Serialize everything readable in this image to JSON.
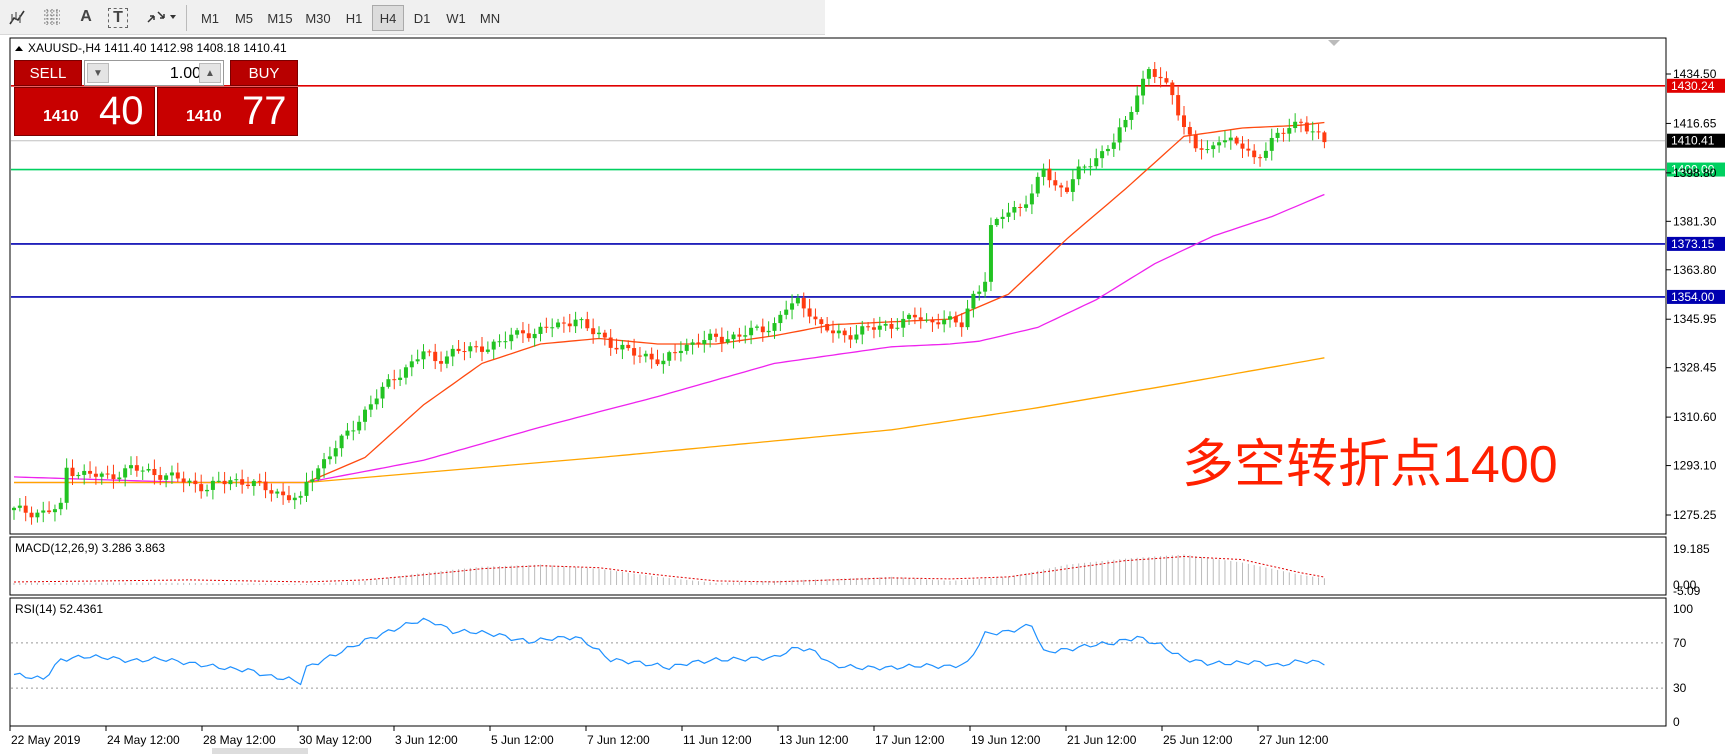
{
  "toolbar": {
    "icons": [
      "chart-type-icon",
      "grid-icon",
      "text-icon",
      "text-label-icon",
      "arrows-icon"
    ],
    "text_icon_label": "A",
    "text_label_icon_label": "T",
    "timeframes": [
      "M1",
      "M5",
      "M15",
      "M30",
      "H1",
      "H4",
      "D1",
      "W1",
      "MN"
    ],
    "active_timeframe": "H4"
  },
  "header": {
    "symbol_info": "XAUUSD-,H4  1411.40 1412.98 1408.18 1410.41"
  },
  "trade": {
    "sell_label": "SELL",
    "buy_label": "BUY",
    "lot_value": "1.00",
    "sell_price_prefix": "1410",
    "sell_price_main": "40",
    "buy_price_prefix": "1410",
    "buy_price_main": "77"
  },
  "annotation": "多空转折点1400",
  "colors": {
    "bull": "#22c322",
    "bear": "#ff3b10",
    "ma_fast": "#ff4a10",
    "ma_mid": "#ee22ee",
    "ma_slow": "#ffa500",
    "resistance": "#e00000",
    "support": "#00d060",
    "level_blue": "#0000b0",
    "annotation": "#ff2000"
  },
  "chart_data": [
    {
      "type": "candlestick",
      "title": "XAUUSD-,H4",
      "ohlc_last": {
        "open": 1411.4,
        "high": 1412.98,
        "low": 1408.18,
        "close": 1410.41
      },
      "price_ticks": [
        "1434.50",
        "1416.65",
        "1398.80",
        "1381.30",
        "1363.80",
        "1345.95",
        "1328.45",
        "1310.60",
        "1293.10",
        "1275.25"
      ],
      "x_labels": [
        "22 May 2019",
        "24 May 12:00",
        "28 May 12:00",
        "30 May 12:00",
        "3 Jun 12:00",
        "5 Jun 12:00",
        "7 Jun 12:00",
        "11 Jun 12:00",
        "13 Jun 12:00",
        "17 Jun 12:00",
        "19 Jun 12:00",
        "21 Jun 12:00",
        "25 Jun 12:00",
        "27 Jun 12:00"
      ],
      "horizontal_lines": [
        {
          "value": 1430.24,
          "label": "1430.24",
          "color": "#e00000"
        },
        {
          "value": 1410.41,
          "label": "1410.41",
          "color": "#c0c0c0"
        },
        {
          "value": 1400.0,
          "label": "1400.00",
          "color": "#00d060"
        },
        {
          "value": 1373.15,
          "label": "1373.15",
          "color": "#0000b0"
        },
        {
          "value": 1354.0,
          "label": "1354.00",
          "color": "#0000b0"
        }
      ],
      "close_path": [
        [
          0,
          1277
        ],
        [
          5,
          1276
        ],
        [
          8,
          1278
        ],
        [
          9,
          1292
        ],
        [
          12,
          1290
        ],
        [
          16,
          1289
        ],
        [
          20,
          1292
        ],
        [
          25,
          1290
        ],
        [
          30,
          1287
        ],
        [
          33,
          1285
        ],
        [
          37,
          1288
        ],
        [
          40,
          1287
        ],
        [
          44,
          1284
        ],
        [
          47,
          1282
        ],
        [
          49,
          1280
        ],
        [
          50,
          1287
        ],
        [
          53,
          1295
        ],
        [
          56,
          1302
        ],
        [
          59,
          1310
        ],
        [
          62,
          1318
        ],
        [
          65,
          1325
        ],
        [
          68,
          1330
        ],
        [
          70,
          1334
        ],
        [
          72,
          1331
        ],
        [
          75,
          1334
        ],
        [
          78,
          1335
        ],
        [
          80,
          1336
        ],
        [
          83,
          1337
        ],
        [
          85,
          1340
        ],
        [
          87,
          1342
        ],
        [
          89,
          1340
        ],
        [
          91,
          1343
        ],
        [
          93,
          1344
        ],
        [
          96,
          1346
        ],
        [
          98,
          1342
        ],
        [
          100,
          1341
        ],
        [
          102,
          1337
        ],
        [
          105,
          1334
        ],
        [
          108,
          1333
        ],
        [
          111,
          1330
        ],
        [
          112,
          1332
        ],
        [
          114,
          1336
        ],
        [
          117,
          1338
        ],
        [
          120,
          1339
        ],
        [
          124,
          1340
        ],
        [
          127,
          1342
        ],
        [
          130,
          1344
        ],
        [
          132,
          1350
        ],
        [
          134,
          1352
        ],
        [
          136,
          1349
        ],
        [
          138,
          1343
        ],
        [
          140,
          1341
        ],
        [
          142,
          1340
        ],
        [
          145,
          1342
        ],
        [
          148,
          1343
        ],
        [
          150,
          1344
        ],
        [
          152,
          1345
        ],
        [
          154,
          1347
        ],
        [
          156,
          1345
        ],
        [
          158,
          1346
        ],
        [
          160,
          1345
        ],
        [
          162,
          1344
        ],
        [
          164,
          1355
        ],
        [
          166,
          1360
        ],
        [
          167,
          1378
        ],
        [
          169,
          1384
        ],
        [
          172,
          1387
        ],
        [
          174,
          1390
        ],
        [
          176,
          1401
        ],
        [
          178,
          1394
        ],
        [
          180,
          1393
        ],
        [
          182,
          1399
        ],
        [
          184,
          1403
        ],
        [
          186,
          1406
        ],
        [
          188,
          1410
        ],
        [
          190,
          1417
        ],
        [
          192,
          1428
        ],
        [
          194,
          1436
        ],
        [
          196,
          1432
        ],
        [
          198,
          1428
        ],
        [
          200,
          1415
        ],
        [
          202,
          1408
        ],
        [
          204,
          1406
        ],
        [
          206,
          1412
        ],
        [
          208,
          1410
        ],
        [
          210,
          1408
        ],
        [
          212,
          1404
        ],
        [
          214,
          1408
        ],
        [
          216,
          1412
        ],
        [
          218,
          1415
        ],
        [
          220,
          1418
        ],
        [
          222,
          1413
        ],
        [
          224,
          1410
        ]
      ],
      "moving_averages": [
        {
          "name": "MA fast",
          "color": "#ff4a10",
          "path": [
            [
              0,
              1287
            ],
            [
              20,
              1287
            ],
            [
              50,
              1287
            ],
            [
              60,
              1296
            ],
            [
              70,
              1315
            ],
            [
              80,
              1330
            ],
            [
              90,
              1337
            ],
            [
              100,
              1339
            ],
            [
              110,
              1337
            ],
            [
              120,
              1337
            ],
            [
              130,
              1340
            ],
            [
              140,
              1344
            ],
            [
              150,
              1345
            ],
            [
              160,
              1346
            ],
            [
              170,
              1355
            ],
            [
              180,
              1375
            ],
            [
              190,
              1393
            ],
            [
              200,
              1412
            ],
            [
              210,
              1415
            ],
            [
              220,
              1416
            ],
            [
              224,
              1417
            ]
          ]
        },
        {
          "name": "MA mid",
          "color": "#ee22ee",
          "path": [
            [
              0,
              1289
            ],
            [
              30,
              1287
            ],
            [
              50,
              1287
            ],
            [
              70,
              1295
            ],
            [
              90,
              1307
            ],
            [
              110,
              1318
            ],
            [
              130,
              1330
            ],
            [
              150,
              1336
            ],
            [
              160,
              1337
            ],
            [
              165,
              1338
            ],
            [
              175,
              1343
            ],
            [
              185,
              1353
            ],
            [
              195,
              1366
            ],
            [
              205,
              1376
            ],
            [
              215,
              1383
            ],
            [
              224,
              1391
            ]
          ]
        },
        {
          "name": "MA slow",
          "color": "#ffa500",
          "path": [
            [
              0,
              1287
            ],
            [
              50,
              1287
            ],
            [
              100,
              1296
            ],
            [
              150,
              1306
            ],
            [
              175,
              1314
            ],
            [
              200,
              1323
            ],
            [
              224,
              1332
            ]
          ]
        }
      ]
    },
    {
      "type": "area",
      "title": "MACD(12,26,9) 3.286 3.863",
      "y_ticks": [
        "19.185",
        "0.00",
        "-5.09"
      ],
      "histogram": [
        [
          0,
          1.0
        ],
        [
          20,
          1.2
        ],
        [
          40,
          0.8
        ],
        [
          50,
          0.5
        ],
        [
          60,
          2
        ],
        [
          70,
          6
        ],
        [
          80,
          9
        ],
        [
          90,
          10
        ],
        [
          100,
          8
        ],
        [
          110,
          4
        ],
        [
          120,
          1
        ],
        [
          130,
          2
        ],
        [
          140,
          3
        ],
        [
          150,
          4
        ],
        [
          160,
          2
        ],
        [
          170,
          4
        ],
        [
          180,
          10
        ],
        [
          190,
          13
        ],
        [
          200,
          15
        ],
        [
          210,
          11
        ],
        [
          220,
          5
        ],
        [
          224,
          3.3
        ]
      ],
      "signal": [
        [
          0,
          1.5
        ],
        [
          30,
          2.5
        ],
        [
          50,
          1.5
        ],
        [
          60,
          2.5
        ],
        [
          70,
          5
        ],
        [
          80,
          8
        ],
        [
          90,
          9.5
        ],
        [
          100,
          8.5
        ],
        [
          110,
          5
        ],
        [
          120,
          2
        ],
        [
          130,
          1.5
        ],
        [
          140,
          2.5
        ],
        [
          150,
          3.5
        ],
        [
          160,
          3
        ],
        [
          170,
          4
        ],
        [
          180,
          8
        ],
        [
          190,
          12
        ],
        [
          200,
          14
        ],
        [
          210,
          12.5
        ],
        [
          220,
          6
        ],
        [
          224,
          3.9
        ]
      ]
    },
    {
      "type": "line",
      "title": "RSI(14) 52.4361",
      "y_ticks": [
        "100",
        "70",
        "30",
        "0"
      ],
      "levels": [
        70,
        30
      ],
      "values": [
        [
          0,
          42
        ],
        [
          5,
          38
        ],
        [
          8,
          55
        ],
        [
          12,
          58
        ],
        [
          16,
          57
        ],
        [
          20,
          54
        ],
        [
          25,
          56
        ],
        [
          30,
          52
        ],
        [
          33,
          50
        ],
        [
          37,
          47
        ],
        [
          40,
          46
        ],
        [
          44,
          40
        ],
        [
          47,
          38
        ],
        [
          49,
          35
        ],
        [
          50,
          48
        ],
        [
          55,
          60
        ],
        [
          60,
          72
        ],
        [
          65,
          82
        ],
        [
          68,
          88
        ],
        [
          70,
          90
        ],
        [
          72,
          88
        ],
        [
          75,
          80
        ],
        [
          78,
          80
        ],
        [
          80,
          79
        ],
        [
          83,
          77
        ],
        [
          85,
          74
        ],
        [
          88,
          71
        ],
        [
          92,
          74
        ],
        [
          96,
          75
        ],
        [
          98,
          70
        ],
        [
          102,
          55
        ],
        [
          106,
          53
        ],
        [
          110,
          50
        ],
        [
          112,
          48
        ],
        [
          115,
          52
        ],
        [
          120,
          55
        ],
        [
          126,
          56
        ],
        [
          130,
          57
        ],
        [
          132,
          62
        ],
        [
          134,
          66
        ],
        [
          137,
          62
        ],
        [
          140,
          50
        ],
        [
          145,
          48
        ],
        [
          150,
          48
        ],
        [
          155,
          50
        ],
        [
          160,
          49
        ],
        [
          163,
          52
        ],
        [
          166,
          78
        ],
        [
          170,
          80
        ],
        [
          174,
          86
        ],
        [
          176,
          62
        ],
        [
          180,
          64
        ],
        [
          184,
          68
        ],
        [
          188,
          70
        ],
        [
          192,
          75
        ],
        [
          196,
          68
        ],
        [
          200,
          56
        ],
        [
          204,
          52
        ],
        [
          208,
          52
        ],
        [
          212,
          53
        ],
        [
          216,
          50
        ],
        [
          220,
          54
        ],
        [
          224,
          52.4
        ]
      ]
    }
  ]
}
